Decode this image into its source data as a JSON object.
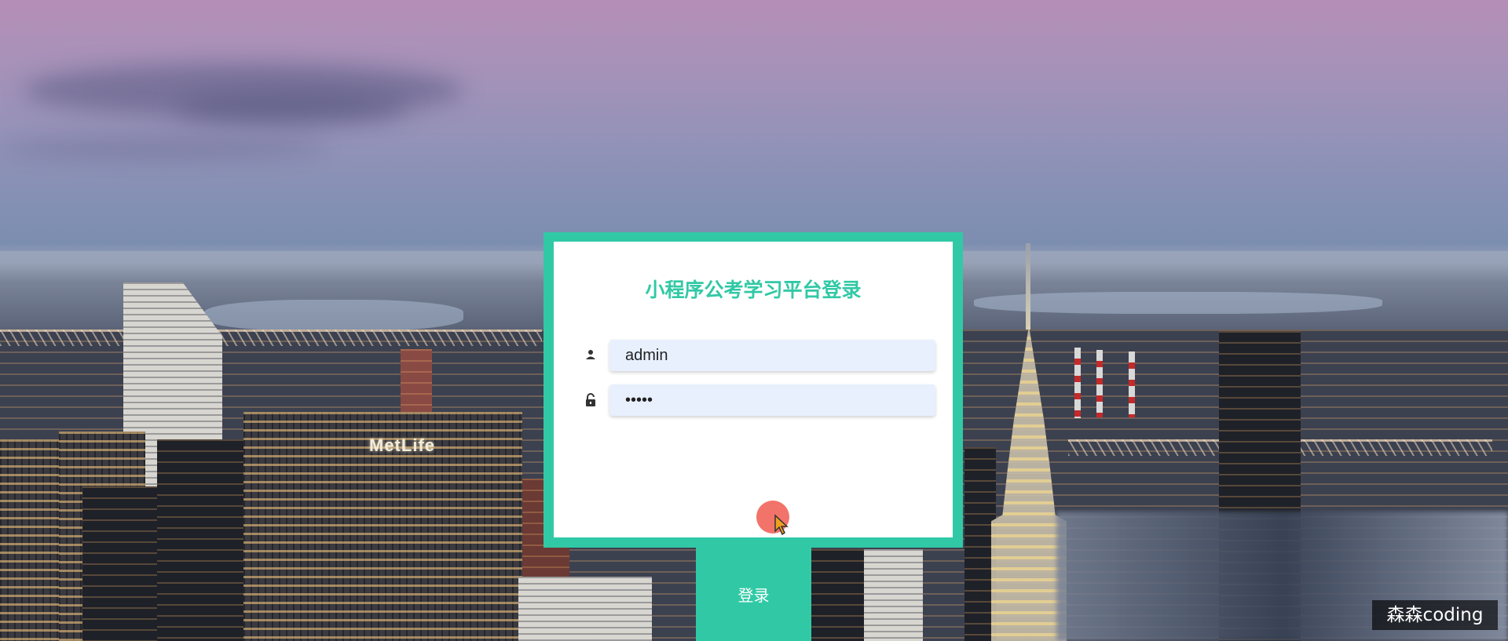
{
  "login": {
    "title": "小程序公考学习平台登录",
    "username": {
      "icon": "user-icon",
      "value": "admin"
    },
    "password": {
      "icon": "lock-icon",
      "value": "•••••"
    },
    "submit_label": "登录"
  },
  "background": {
    "sign_text": "MetLife"
  },
  "watermark": {
    "text": "森森coding"
  },
  "colors": {
    "accent": "#31c9a5",
    "input_bg": "#e8f0fe",
    "cursor_highlight": "#f05a50"
  }
}
